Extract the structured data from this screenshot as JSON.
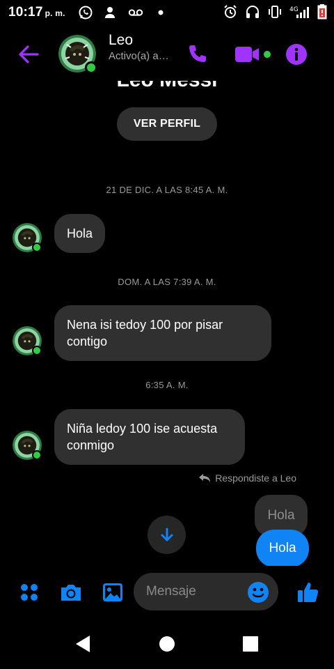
{
  "status_bar": {
    "time": "10:17",
    "ampm": "p. m.",
    "icons": [
      "whatsapp-icon",
      "person-icon",
      "voicemail-icon",
      "dot-icon",
      "alarm-icon",
      "headphones-icon",
      "vibrate-icon",
      "signal-icon",
      "battery-icon"
    ],
    "network_label": "4G"
  },
  "header": {
    "name": "Leo",
    "status": "Activo(a) a…",
    "accent": "#a033ff",
    "online_color": "#31cc46"
  },
  "chat": {
    "name_cut": "Leo Messi",
    "view_profile_label": "VER PERFIL",
    "timestamps": [
      "21 DE DIC. A LAS 8:45 A. M.",
      "DOM. A LAS 7:39 A. M.",
      "6:35 A. M."
    ],
    "messages_in": [
      "Hola",
      "Nena isi tedoy 100 por pisar contigo",
      "Niña ledoy 100 ise acuesta conmigo"
    ],
    "reply_note": "Respondiste a Leo",
    "quoted_text": "Hola",
    "sent_text": "Hola",
    "sent_color": "#1083f5"
  },
  "composer": {
    "placeholder": "Mensaje",
    "icons": [
      "apps-icon",
      "camera-icon",
      "gallery-icon",
      "emoji-icon",
      "thumbs-up-icon"
    ],
    "accent": "#1083f5"
  },
  "navbar": {
    "icons": [
      "back-triangle-icon",
      "home-circle-icon",
      "recents-square-icon"
    ]
  }
}
